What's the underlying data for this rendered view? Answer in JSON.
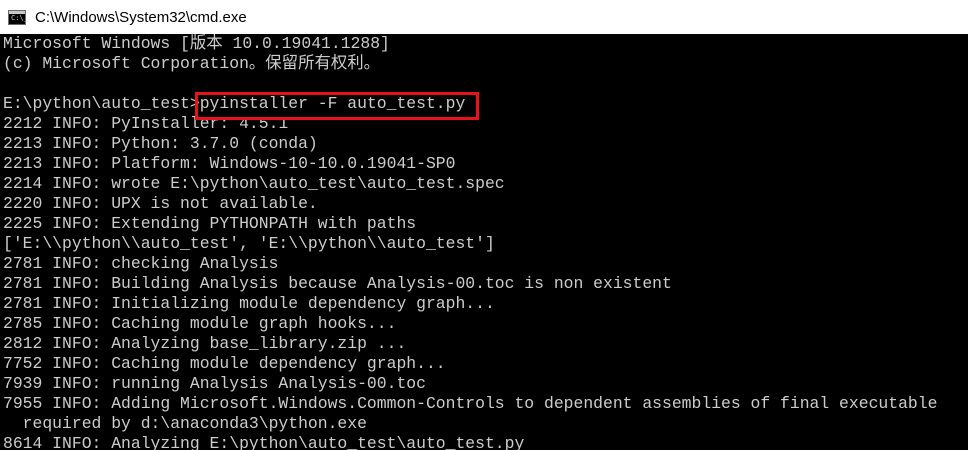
{
  "window": {
    "title": "C:\\Windows\\System32\\cmd.exe",
    "icon": "cmd-console-icon",
    "icon_glyph": "C:\\_"
  },
  "colors": {
    "titlebar_bg": "#ffffff",
    "console_bg": "#000000",
    "console_text": "#cccccc",
    "highlight_border": "#e8121b"
  },
  "console": {
    "lines": [
      "Microsoft Windows [版本 10.0.19041.1288]",
      "(c) Microsoft Corporation。保留所有权利。",
      "",
      "E:\\python\\auto_test>pyinstaller -F auto_test.py",
      "2212 INFO: PyInstaller: 4.5.1",
      "2213 INFO: Python: 3.7.0 (conda)",
      "2213 INFO: Platform: Windows-10-10.0.19041-SP0",
      "2214 INFO: wrote E:\\python\\auto_test\\auto_test.spec",
      "2220 INFO: UPX is not available.",
      "2225 INFO: Extending PYTHONPATH with paths",
      "['E:\\\\python\\\\auto_test', 'E:\\\\python\\\\auto_test']",
      "2781 INFO: checking Analysis",
      "2781 INFO: Building Analysis because Analysis-00.toc is non existent",
      "2781 INFO: Initializing module dependency graph...",
      "2785 INFO: Caching module graph hooks...",
      "2812 INFO: Analyzing base_library.zip ...",
      "7752 INFO: Caching module dependency graph...",
      "7939 INFO: running Analysis Analysis-00.toc",
      "7955 INFO: Adding Microsoft.Windows.Common-Controls to dependent assemblies of final executable",
      "  required by d:\\anaconda3\\python.exe",
      "8614 INFO: Analyzing E:\\python\\auto_test\\auto_test.py"
    ]
  }
}
